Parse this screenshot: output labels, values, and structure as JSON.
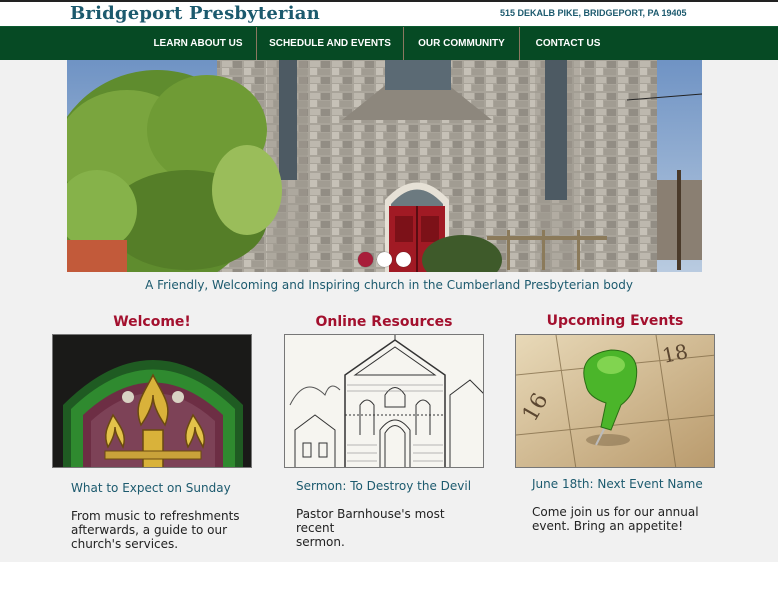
{
  "header": {
    "site_title": "Bridgeport Presbyterian",
    "address": "515 DEKALB PIKE, BRIDGEPORT, PA 19405"
  },
  "nav": {
    "items": [
      "LEARN ABOUT US",
      "SCHEDULE AND EVENTS",
      "OUR COMMUNITY",
      "CONTACT US"
    ]
  },
  "hero": {
    "slide_count": 3,
    "active_slide": 1
  },
  "tagline": "A Friendly, Welcoming and Inspiring church in the Cumberland Presbyterian body",
  "columns": [
    {
      "heading": "Welcome!",
      "link": "What to Expect on Sunday",
      "desc_lines": [
        "From music to refreshments",
        "afterwards, a guide to our",
        "church's services."
      ]
    },
    {
      "heading": "Online Resources",
      "link": "Sermon: To Destroy the Devil",
      "desc_lines": [
        "Pastor Barnhouse's most recent",
        "sermon."
      ]
    },
    {
      "heading": "Upcoming Events",
      "link": "June 18th: Next Event Name",
      "desc_lines": [
        "Come join us for our annual",
        "event. Bring an appetite!"
      ],
      "calendar_numbers": [
        "16",
        "18"
      ]
    }
  ],
  "colors": {
    "brand_blue": "#1c5a6e",
    "nav_green": "#064a24",
    "heading_red": "#a3102e"
  }
}
